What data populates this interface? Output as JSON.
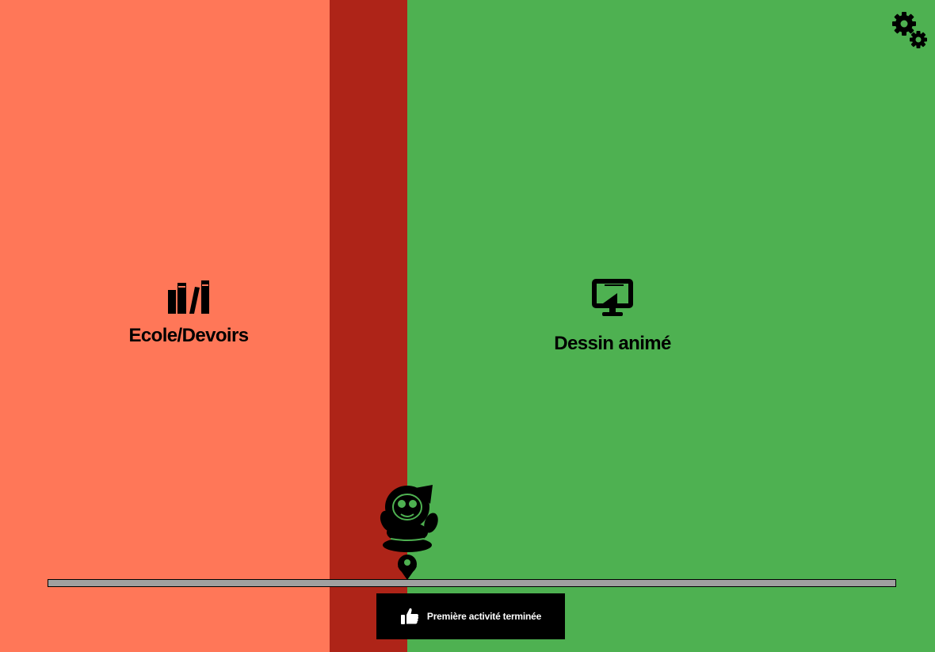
{
  "colors": {
    "left_panel": "#FF7758",
    "divider": "#AE2418",
    "right_panel": "#4EB151",
    "track": "#A0A0A0",
    "banner": "#000000",
    "banner_text": "#FFFFFF",
    "icon": "#000000"
  },
  "activities": [
    {
      "label": "Ecole/Devoirs",
      "icon": "books-icon"
    },
    {
      "label": "Dessin animé",
      "icon": "monitor-icon"
    }
  ],
  "settings": {
    "icon": "gears-icon"
  },
  "timeline": {
    "progress": 0.425
  },
  "mascot": {
    "icon": "astronaut-icon"
  },
  "status": {
    "icon": "thumbs-up-icon",
    "text": "Première activité terminée"
  }
}
